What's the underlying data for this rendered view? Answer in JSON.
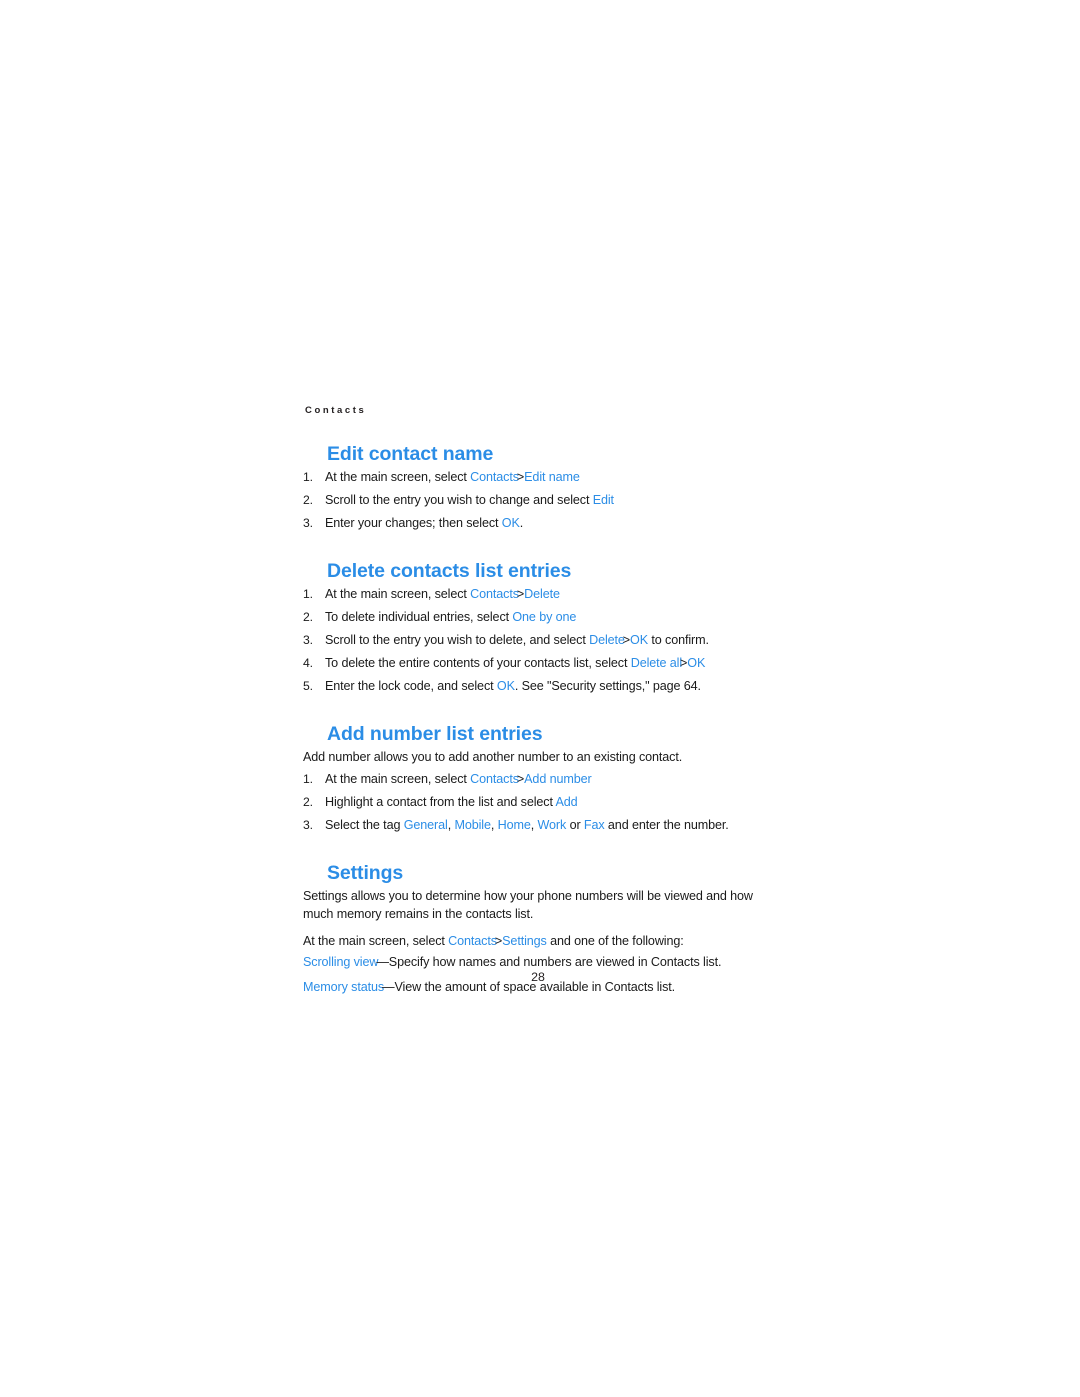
{
  "document": {
    "running_header": "Contacts",
    "page_number": "28",
    "accent_color": "#2b8de6",
    "text_color": "#1a1a1a"
  },
  "sections": [
    {
      "heading": "Edit contact name",
      "steps": [
        {
          "lead": "At the main screen, select ",
          "term1": "Contacts",
          "sep": ">",
          "term2": "Edit name",
          "tail": ""
        },
        {
          "lead": "Scroll to the entry you wish to change and select ",
          "term1": "Edit",
          "tail": ""
        },
        {
          "lead": "Enter your changes; then select ",
          "term1": "OK",
          "tail": "."
        }
      ]
    },
    {
      "heading": "Delete contacts list entries",
      "steps": [
        {
          "lead": "At the main screen, select ",
          "term1": "Contacts",
          "sep": ">",
          "term2": "Delete",
          "tail": ""
        },
        {
          "lead": "To delete individual entries, select ",
          "term1": "One by one",
          "tail": ""
        },
        {
          "lead": "Scroll to the entry you wish to delete, and select ",
          "term1": "Delete",
          "sep": ">",
          "term2": "OK",
          "tail": " to confirm."
        },
        {
          "lead": "To delete the entire contents of your contacts list, select ",
          "term1": "Delete all",
          "sep": ">",
          "term2": "OK",
          "tail": ""
        },
        {
          "lead": "Enter the lock code, and select ",
          "term1": "OK",
          "tail": ". See \"Security settings,\" page 64."
        }
      ]
    },
    {
      "heading": "Add number list entries",
      "intro": "Add number allows you to add another number to an existing contact.",
      "steps": [
        {
          "lead": "At the main screen, select ",
          "term1": "Contacts",
          "sep": ">",
          "term2": "Add number",
          "tail": ""
        },
        {
          "lead": "Highlight a contact from the list and select ",
          "term1": "Add",
          "tail": ""
        },
        {
          "lead": "Select the tag ",
          "tags": [
            "General",
            "Mobile",
            "Home",
            "Work",
            "Fax"
          ],
          "tag_sep": ", ",
          "tag_conj": " or ",
          "tail": " and enter the number."
        }
      ]
    },
    {
      "heading": "Settings",
      "intro": "Settings allows you to determine how your phone numbers will be viewed and how much memory remains in the contacts list.",
      "path_line": {
        "lead": "At the main screen, select ",
        "term1": "Contacts",
        "sep": ">",
        "term2": "Settings",
        "tail": " and one of the following:"
      },
      "definitions": [
        {
          "term": "Scrolling view",
          "description": "—Specify how names and numbers are viewed in Contacts list."
        },
        {
          "term": "Memory status",
          "description": "—View the amount of space available in Contacts list."
        }
      ]
    }
  ]
}
